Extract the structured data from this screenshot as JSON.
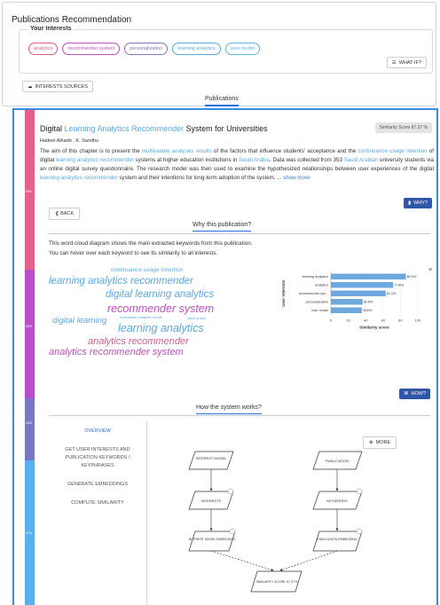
{
  "header": {
    "title": "Publications Recommendation",
    "interests_label": "Your Interests",
    "interests": [
      {
        "label": "analytics",
        "color": "#e05a8a"
      },
      {
        "label": "recommender system",
        "color": "#c24fc0"
      },
      {
        "label": "personalization",
        "color": "#7a7ab8"
      },
      {
        "label": "learning analytics",
        "color": "#5aa8e8"
      },
      {
        "label": "user model",
        "color": "#5ab8e0"
      }
    ],
    "whatif_label": "WHAT-IF?",
    "sources_label": "INTERESTS SOURCES",
    "tab_label": "Publications"
  },
  "publication": {
    "title_parts": [
      "Digital ",
      "Learning Analytics Recommender",
      " System for Universities"
    ],
    "similarity": "Similarity Score  87.37 %",
    "authors": "Hadeel Alharbi , K. Sandhu",
    "abstract_parts": [
      {
        "t": "The aim of this chapter is to present the ",
        "hl": false
      },
      {
        "t": "multivariate analyses results",
        "hl": true
      },
      {
        "t": " of the factors that influence students' acceptance and the ",
        "hl": false
      },
      {
        "t": "continuance usage intention",
        "hl": true
      },
      {
        "t": " of digital ",
        "hl": false
      },
      {
        "t": "learning analytics recommender",
        "hl": true
      },
      {
        "t": " systems at higher education institutions in ",
        "hl": false
      },
      {
        "t": "Saudi Arabia",
        "hl": true
      },
      {
        "t": ". Data was collected from 353 ",
        "hl": false
      },
      {
        "t": "Saudi Arabian",
        "hl": true
      },
      {
        "t": " university students via an online digital survey questionnaire. The research model was then used to examine the hypothesized relationships between user experiences of the digital ",
        "hl": false
      },
      {
        "t": "learning analytics recommender",
        "hl": true
      },
      {
        "t": " system and their intentions for long-term adoption of the system. ... ",
        "hl": false
      }
    ],
    "show_more": "show more",
    "why_label": "WHY?",
    "back_label": "BACK"
  },
  "rank_segments": [
    {
      "label": "89%",
      "color": "#e8608a"
    },
    {
      "label": "62%",
      "color": "#b84fc8"
    },
    {
      "label": "22%",
      "color": "#7a78c0"
    },
    {
      "label": "47%",
      "color": "#5ab0ec"
    }
  ],
  "why": {
    "title": "Why this publication?",
    "desc_line1": "This word cloud diagram shows the main extracted keywords from this publication.",
    "desc_line2": "You can hover over each keyword to see its similarity to all interests.",
    "words": [
      {
        "text": "continuance usage intention",
        "color": "#5aa8e8"
      },
      {
        "text": "learning analytics recommender",
        "color": "#5aa8e8"
      },
      {
        "text": "digital learning analytics",
        "color": "#5aa8e8"
      },
      {
        "text": "recommender system",
        "color": "#c24fc0"
      },
      {
        "text": "digital learning",
        "color": "#5aa8e8"
      },
      {
        "text": "multivariate analyses results",
        "color": "#5aa8e8"
      },
      {
        "text": "saudi arabia",
        "color": "#5aa8e8"
      },
      {
        "text": "learning analytics",
        "color": "#5aa8e8"
      },
      {
        "text": "analytics recommender",
        "color": "#e05a8a"
      },
      {
        "text": "analytics recommender system",
        "color": "#c24fc0"
      }
    ]
  },
  "chart_data": {
    "type": "bar",
    "orientation": "horizontal",
    "categories": [
      "learning analytics",
      "analytics",
      "recommender sys...",
      "personalization",
      "user model"
    ],
    "values": [
      86.34,
      71.66,
      63.12,
      36.46,
      35.53
    ],
    "value_labels": [
      "86.34%",
      "71.66%",
      "63.12%",
      "36.46%",
      "35.53%"
    ],
    "xlabel": "Similarity score",
    "ylabel": "User interests",
    "xlim": [
      0,
      100
    ],
    "xticks": [
      "0",
      "20",
      "40",
      "60",
      "80",
      "100"
    ],
    "bar_color": "#6fa8dc"
  },
  "how": {
    "button_label": "HOW?",
    "title": "How the system works?",
    "menu": [
      "OVERVIEW",
      "GET USER INTERESTS AND PUBLICATION KEYWORDS / KEYPHRASES",
      "GENERATE EMBEDDINGS",
      "COMPUTE SIMILARITY"
    ],
    "more_label": "MORE",
    "flow": {
      "interest_model": "INTEREST MODEL",
      "publication": "PUBLICATION",
      "interests": "INTERESTS",
      "keywords": "KEYWORDS",
      "interest_model_embedding": "INTEREST MODEL EMBEDDING",
      "publication_embedding": "PUBLICATION EMBEDDING",
      "similarity_score": "SIMILARITY SCORE: 87.37%"
    }
  }
}
